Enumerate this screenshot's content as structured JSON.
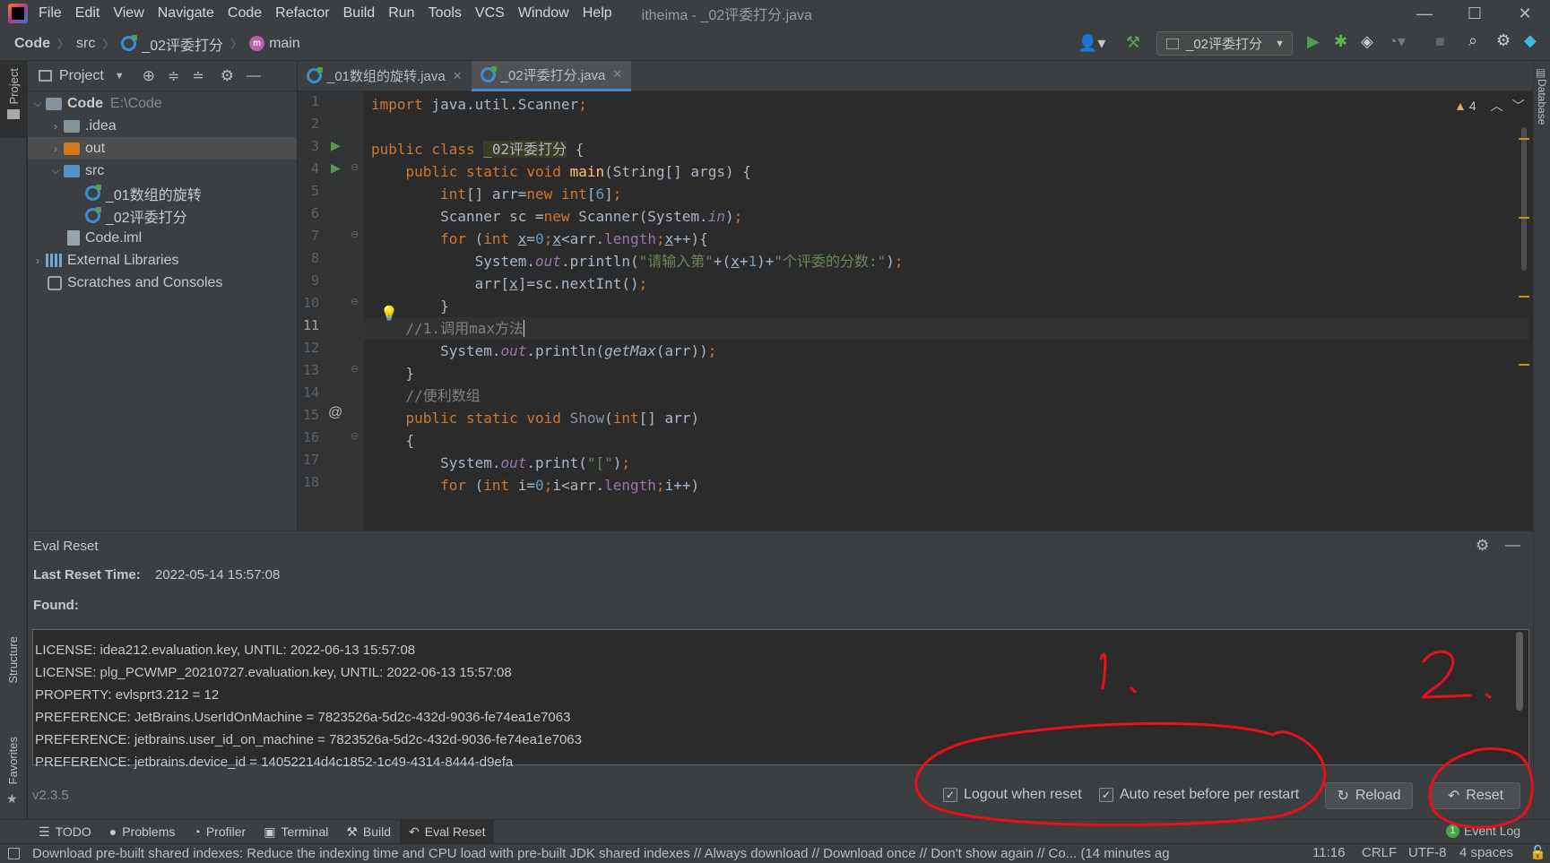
{
  "menubar": {
    "items": [
      "File",
      "Edit",
      "View",
      "Navigate",
      "Code",
      "Refactor",
      "Build",
      "Run",
      "Tools",
      "VCS",
      "Window",
      "Help"
    ],
    "window_title": "itheima - _02评委打分.java"
  },
  "navbar": {
    "crumbs": [
      "Code",
      "src",
      "_02评委打分",
      "main"
    ],
    "run_config": "_02评委打分"
  },
  "left_strip": {
    "project": "Project",
    "structure": "Structure",
    "favorites": "Favorites"
  },
  "right_strip": {
    "database": "Database"
  },
  "project_panel": {
    "title": "Project",
    "tree": [
      {
        "label": "Code",
        "hint": "E:\\Code"
      },
      {
        "label": ".idea"
      },
      {
        "label": "out"
      },
      {
        "label": "src"
      },
      {
        "label": "_01数组的旋转"
      },
      {
        "label": "_02评委打分"
      },
      {
        "label": "Code.iml"
      },
      {
        "label": "External Libraries"
      },
      {
        "label": "Scratches and Consoles"
      }
    ]
  },
  "editor": {
    "tabs": [
      {
        "label": "_01数组的旋转.java"
      },
      {
        "label": "_02评委打分.java"
      }
    ],
    "warnings": "4",
    "line_numbers": [
      "1",
      "2",
      "3",
      "4",
      "5",
      "6",
      "7",
      "8",
      "9",
      "10",
      "11",
      "12",
      "13",
      "14",
      "15",
      "16",
      "17",
      "18"
    ]
  },
  "eval_reset": {
    "title": "Eval Reset",
    "last_reset_label": "Last Reset Time:",
    "last_reset_value": "2022-05-14 15:57:08",
    "found_label": "Found:",
    "found_lines": [
      "LICENSE: idea212.evaluation.key, UNTIL: 2022-06-13 15:57:08",
      "LICENSE: plg_PCWMP_20210727.evaluation.key, UNTIL: 2022-06-13 15:57:08",
      "PROPERTY: evlsprt3.212 = 12",
      "PREFERENCE: JetBrains.UserIdOnMachine = 7823526a-5d2c-432d-9036-fe74ea1e7063",
      "PREFERENCE: jetbrains.user_id_on_machine = 7823526a-5d2c-432d-9036-fe74ea1e7063",
      "PREFERENCE: jetbrains.device_id = 14052214d4c1852-1c49-4314-8444-d9efa"
    ],
    "version": "v2.3.5",
    "logout_label": "Logout when reset",
    "auto_reset_label": "Auto reset before per restart",
    "reload_label": "Reload",
    "reset_label": "Reset"
  },
  "bottom_tabs": [
    "TODO",
    "Problems",
    "Profiler",
    "Terminal",
    "Build",
    "Eval Reset"
  ],
  "event_log": {
    "count": "1",
    "label": "Event Log"
  },
  "statusbar": {
    "message": "Download pre-built shared indexes: Reduce the indexing time and CPU load with pre-built JDK shared indexes // Always download // Download once // Don't show again // Co... (14 minutes ag",
    "position": "11:16",
    "line_sep": "CRLF",
    "encoding": "UTF-8",
    "indent": "4 spaces"
  },
  "annotations": {
    "one": "1.",
    "two": "2."
  },
  "colors": {
    "accent": "#4a88c7",
    "annotation": "#e8101a",
    "run_green": "#4fa04a"
  }
}
